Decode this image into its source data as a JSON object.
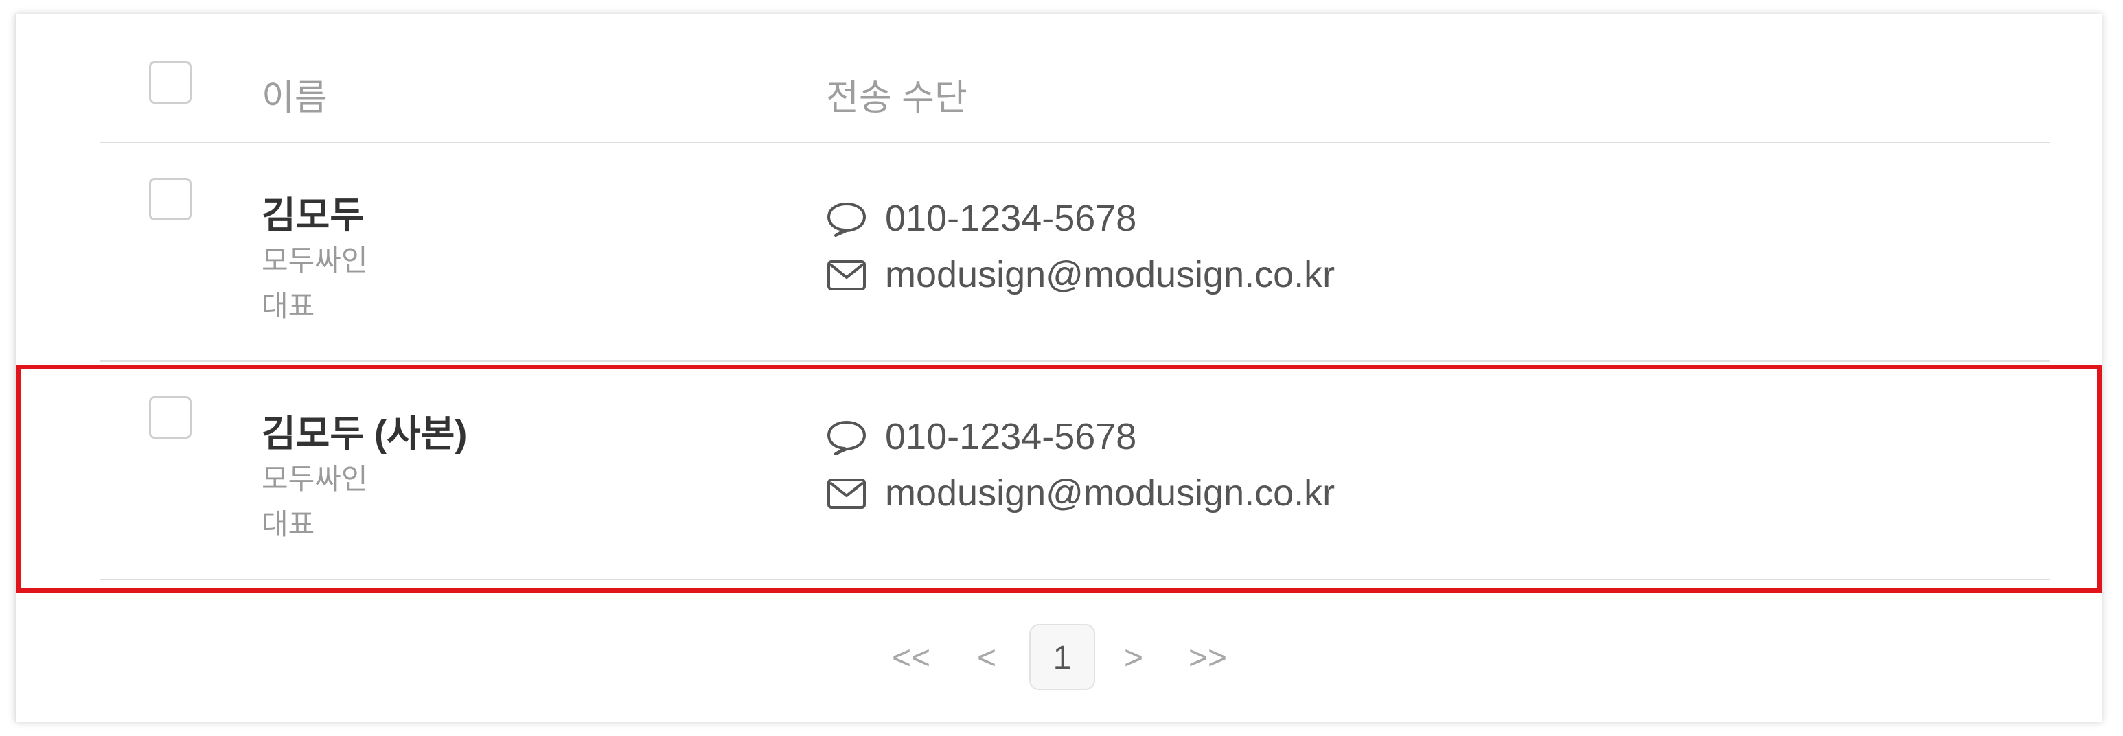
{
  "table": {
    "headers": {
      "name": "이름",
      "channel": "전송 수단"
    },
    "rows": [
      {
        "name": "김모두",
        "company": "모두싸인",
        "title": "대표",
        "phone": "010-1234-5678",
        "email": "modusign@modusign.co.kr",
        "phone_icon": "speech-bubble-icon",
        "email_icon": "envelope-icon"
      },
      {
        "name": "김모두 (사본)",
        "company": "모두싸인",
        "title": "대표",
        "phone": "010-1234-5678",
        "email": "modusign@modusign.co.kr",
        "phone_icon": "speech-bubble-icon",
        "email_icon": "envelope-icon",
        "highlighted": true
      }
    ]
  },
  "pagination": {
    "first": "<<",
    "prev": "<",
    "current": "1",
    "next": ">",
    "last": ">>"
  },
  "colors": {
    "highlight": "#e1131b",
    "divider": "#dedede",
    "muted_text": "#9a9a9a"
  }
}
